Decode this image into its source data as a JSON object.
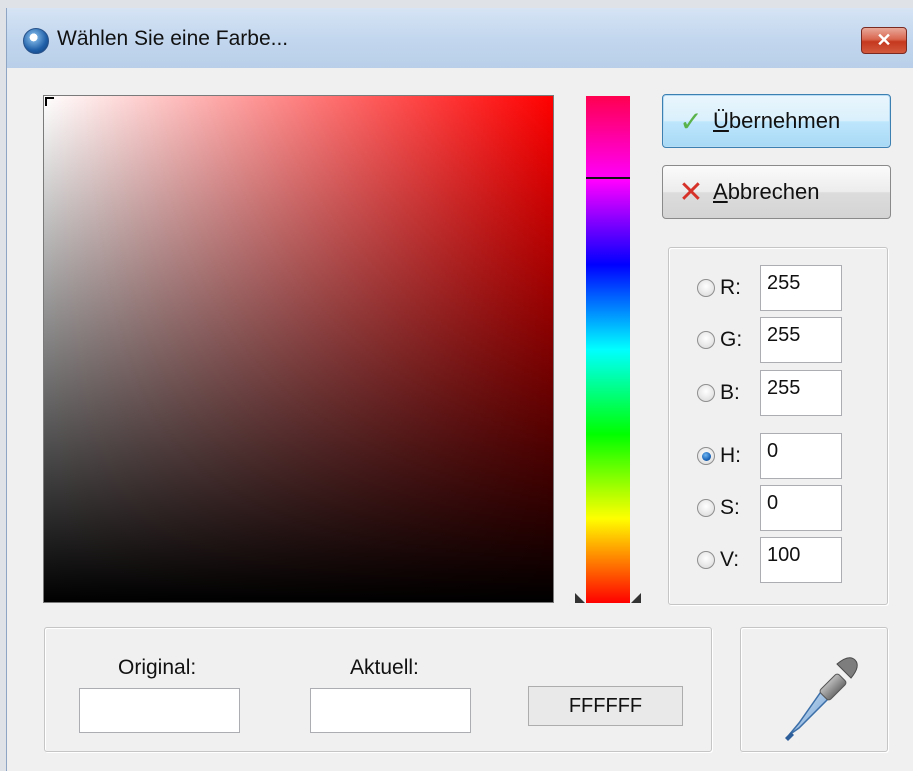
{
  "window": {
    "title": "Wählen Sie eine Farbe...",
    "close_label": "✕"
  },
  "buttons": {
    "apply_label_first": "Ü",
    "apply_label_rest": "bernehmen",
    "cancel_label_first": "A",
    "cancel_label_rest": "bbrechen",
    "apply_icon": "check-icon",
    "cancel_icon": "cross-icon"
  },
  "values": {
    "r_label": "R:",
    "r_value": "255",
    "g_label": "G:",
    "g_value": "255",
    "b_label": "B:",
    "b_value": "255",
    "h_label": "H:",
    "h_value": "0",
    "s_label": "S:",
    "s_value": "0",
    "v_label": "V:",
    "v_value": "100",
    "selected_mode": "H"
  },
  "preview": {
    "original_label": "Original:",
    "current_label": "Aktuell:",
    "original_color": "#FFFFFF",
    "current_color": "#FFFFFF",
    "hex_value": "FFFFFF"
  },
  "hue_level": 0.84,
  "pipette_icon": "eyedropper-icon"
}
